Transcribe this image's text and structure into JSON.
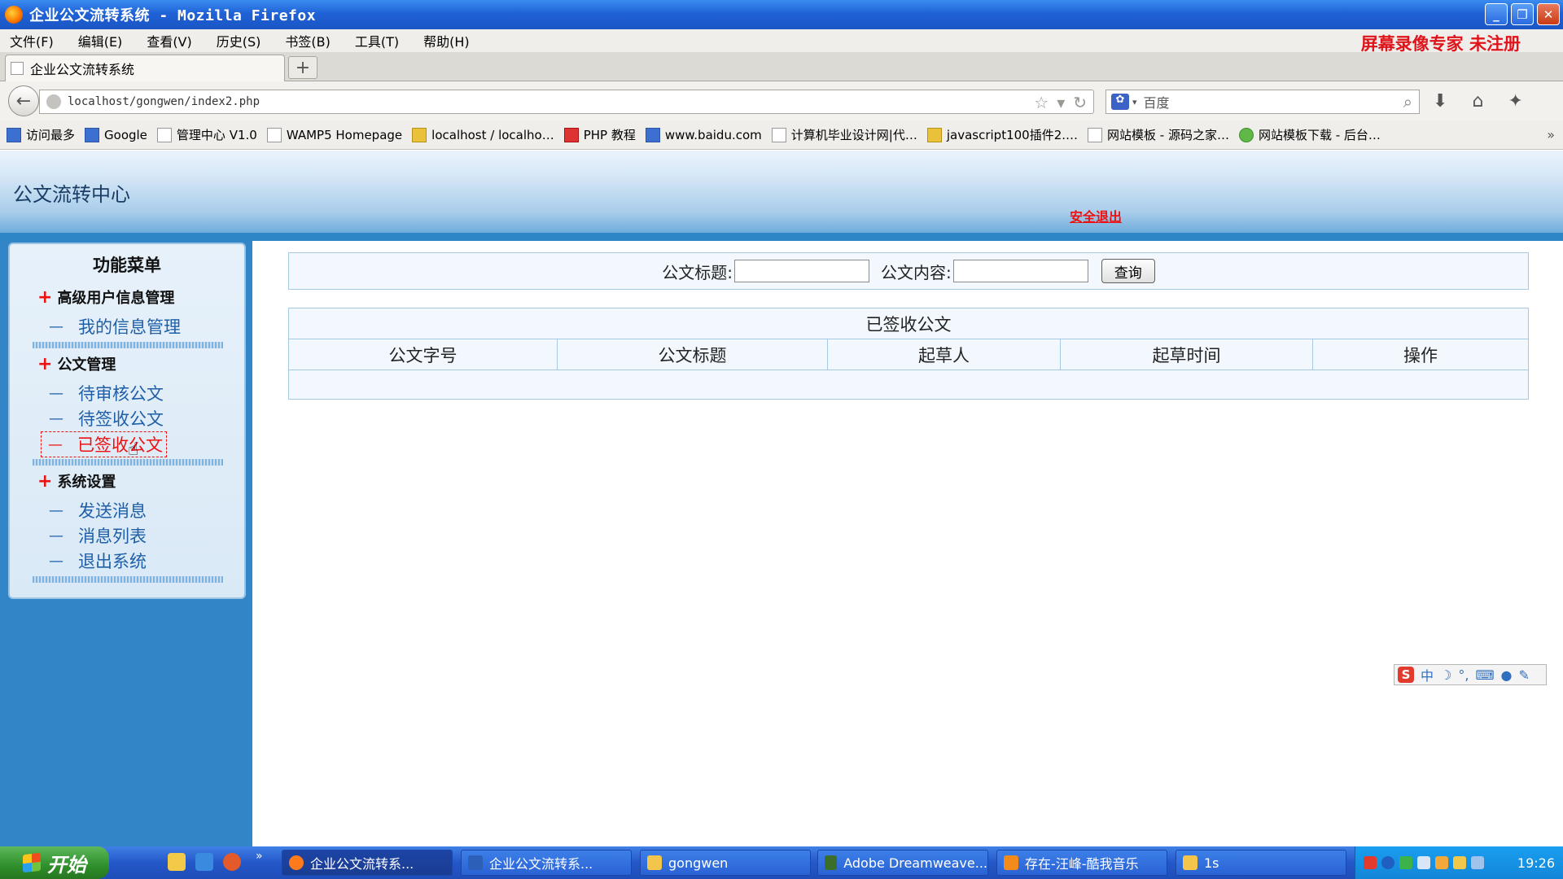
{
  "window": {
    "title": "企业公文流转系统 - Mozilla Firefox",
    "watermark": "屏幕录像专家 未注册"
  },
  "menubar": [
    "文件(F)",
    "编辑(E)",
    "查看(V)",
    "历史(S)",
    "书签(B)",
    "工具(T)",
    "帮助(H)"
  ],
  "tab": {
    "label": "企业公文流转系统",
    "new_tab": "+"
  },
  "nav": {
    "url": "localhost/gongwen/index2.php",
    "search_engine": "百度"
  },
  "bookmarks": [
    {
      "label": "访问最多",
      "icon": "blue"
    },
    {
      "label": "Google",
      "icon": "blue"
    },
    {
      "label": "管理中心 V1.0",
      "icon": "plain"
    },
    {
      "label": "WAMP5 Homepage",
      "icon": "plain"
    },
    {
      "label": "localhost / localho…",
      "icon": "yellow"
    },
    {
      "label": "PHP 教程",
      "icon": "red"
    },
    {
      "label": "www.baidu.com",
      "icon": "blue"
    },
    {
      "label": "计算机毕业设计网|代…",
      "icon": "plain"
    },
    {
      "label": "javascript100插件2.…",
      "icon": "yellow"
    },
    {
      "label": "网站模板 - 源码之家…",
      "icon": "plain"
    },
    {
      "label": "网站模板下载 - 后台…",
      "icon": "green"
    }
  ],
  "header": {
    "title": "公文流转中心",
    "logout": "安全退出"
  },
  "sidebar": {
    "title": "功能菜单",
    "groups": [
      {
        "label": "高级用户信息管理",
        "items": [
          "我的信息管理"
        ]
      },
      {
        "label": "公文管理",
        "items": [
          "待审核公文",
          "待签收公文",
          "已签收公文"
        ]
      },
      {
        "label": "系统设置",
        "items": [
          "发送消息",
          "消息列表",
          "退出系统"
        ]
      }
    ],
    "plus": "+",
    "dash": "—"
  },
  "search": {
    "title_label": "公文标题:",
    "content_label": "公文内容:",
    "title_value": "",
    "content_value": "",
    "button": "查询"
  },
  "table": {
    "caption": "已签收公文",
    "columns": [
      "公文字号",
      "公文标题",
      "起草人",
      "起草时间",
      "操作"
    ]
  },
  "ime": {
    "lang": "中"
  },
  "taskbar": {
    "start": "开始",
    "tasks": [
      {
        "label": "企业公文流转系...",
        "color": "#ff7a1a"
      },
      {
        "label": "企业公文流转系...",
        "color": "#2b5fb8"
      },
      {
        "label": "gongwen",
        "color": "#f3c54a"
      },
      {
        "label": "Adobe Dreamweave...",
        "color": "#3a6e2a"
      },
      {
        "label": "存在-汪峰-酷我音乐",
        "color": "#f28a1c"
      },
      {
        "label": "1s",
        "color": "#f3c54a"
      }
    ],
    "clock": "19:26"
  }
}
